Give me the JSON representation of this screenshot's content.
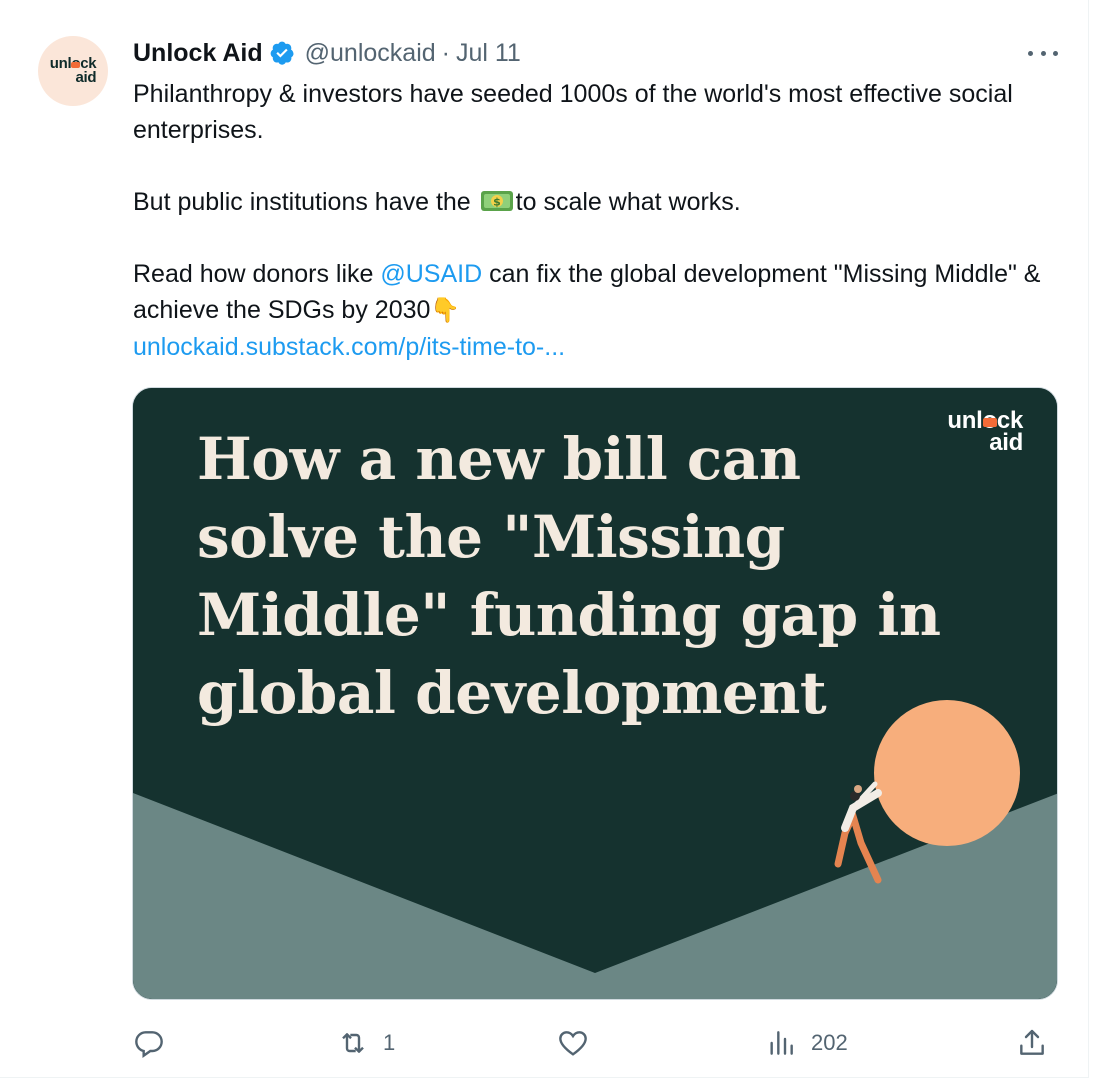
{
  "tweet": {
    "author_name": "Unlock Aid",
    "handle": "@unlockaid",
    "separator": "·",
    "date": "Jul 11",
    "avatar_logo_line1": "unlock",
    "avatar_logo_line2": "aid",
    "text": {
      "p1": "Philanthropy & investors have seeded 1000s of the world's most effective social enterprises.",
      "p2_before": "But public institutions have the ",
      "p2_emoji": "💵",
      "p2_after": "to scale what works.",
      "p3_before": "Read how donors like ",
      "p3_mention": "@USAID",
      "p3_after": " can fix the global development \"Missing Middle\" & achieve the SDGs by 2030",
      "p3_emoji": "👇",
      "link": "unlockaid.substack.com/p/its-time-to-..."
    },
    "media": {
      "headline": "How a new bill can solve the \"Missing Middle\" funding gap in global development",
      "logo_line1": "unlock",
      "logo_line2": "aid",
      "colors": {
        "background": "#15322f",
        "hill": "#6b8785",
        "ball": "#f7ae7c",
        "accent": "#f26b38"
      }
    },
    "actions": {
      "reply_count": "",
      "retweet_count": "1",
      "like_count": "",
      "views_count": "202"
    },
    "icons": [
      "verified-badge-icon",
      "more-icon",
      "reply-icon",
      "retweet-icon",
      "like-icon",
      "views-icon",
      "share-icon"
    ]
  }
}
